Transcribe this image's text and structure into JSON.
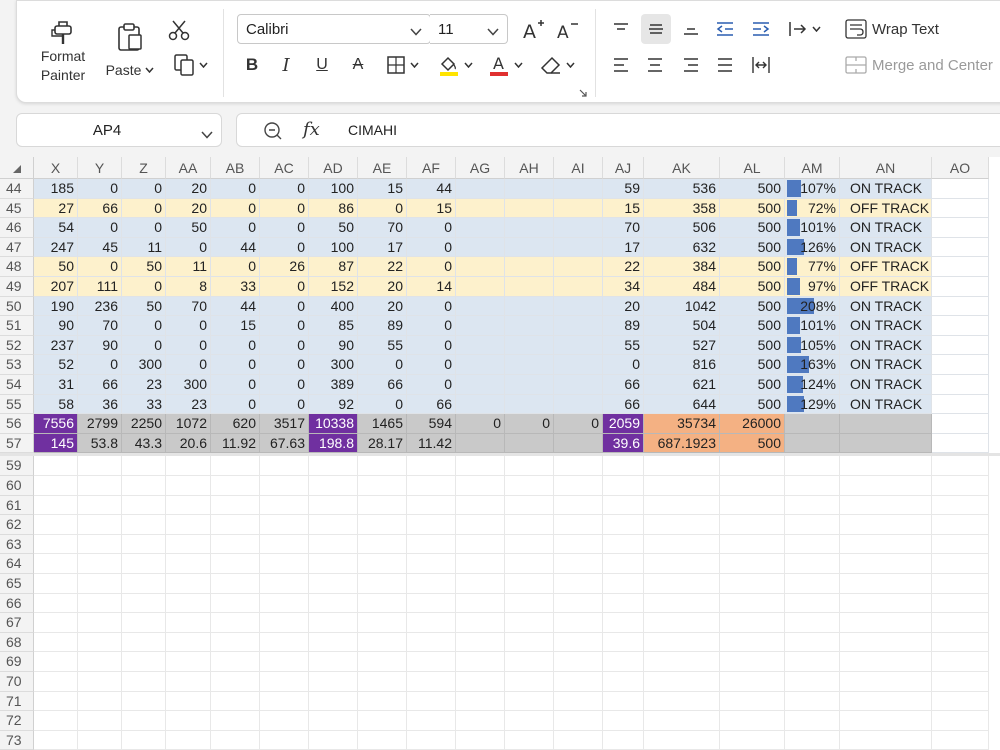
{
  "ribbon": {
    "format_painter_label_1": "Format",
    "format_painter_label_2": "Painter",
    "paste_label": "Paste",
    "font_name": "Calibri",
    "font_size": "11",
    "wrap_text_label": "Wrap Text",
    "merge_center_label": "Merge and Center"
  },
  "formula_bar": {
    "name_box": "AP4",
    "formula": "CIMAHI",
    "fx_label": "fx"
  },
  "colors": {
    "blue_row": "#dce6f1",
    "yellow_row": "#fdf1cc",
    "purple": "#7030a0",
    "gray": "#c9c9c9",
    "orange": "#f4b183",
    "databar": "#4f79c0"
  },
  "columns": [
    "X",
    "Y",
    "Z",
    "AA",
    "AB",
    "AC",
    "AD",
    "AE",
    "AF",
    "AG",
    "AH",
    "AI",
    "AJ",
    "AK",
    "AL",
    "AM",
    "AN",
    "AO"
  ],
  "rows": [
    {
      "num": "44",
      "style": "blue",
      "cells": [
        "185",
        "0",
        "0",
        "20",
        "0",
        "0",
        "100",
        "15",
        "44",
        "",
        "",
        "",
        "59",
        "536",
        "500",
        "107%",
        "ON TRACK"
      ],
      "bar": 0.29
    },
    {
      "num": "45",
      "style": "yellow",
      "cells": [
        "27",
        "66",
        "0",
        "20",
        "0",
        "0",
        "86",
        "0",
        "15",
        "",
        "",
        "",
        "15",
        "358",
        "500",
        "72%",
        "OFF TRACK"
      ],
      "bar": 0.2
    },
    {
      "num": "46",
      "style": "blue",
      "cells": [
        "54",
        "0",
        "0",
        "50",
        "0",
        "0",
        "50",
        "70",
        "0",
        "",
        "",
        "",
        "70",
        "506",
        "500",
        "101%",
        "ON TRACK"
      ],
      "bar": 0.27
    },
    {
      "num": "47",
      "style": "blue",
      "cells": [
        "247",
        "45",
        "11",
        "0",
        "44",
        "0",
        "100",
        "17",
        "0",
        "",
        "",
        "",
        "17",
        "632",
        "500",
        "126%",
        "ON TRACK"
      ],
      "bar": 0.34
    },
    {
      "num": "48",
      "style": "yellow",
      "cells": [
        "50",
        "0",
        "50",
        "11",
        "0",
        "26",
        "87",
        "22",
        "0",
        "",
        "",
        "",
        "22",
        "384",
        "500",
        "77%",
        "OFF TRACK"
      ],
      "bar": 0.21
    },
    {
      "num": "49",
      "style": "yellow",
      "cells": [
        "207",
        "111",
        "0",
        "8",
        "33",
        "0",
        "152",
        "20",
        "14",
        "",
        "",
        "",
        "34",
        "484",
        "500",
        "97%",
        "OFF TRACK"
      ],
      "bar": 0.26
    },
    {
      "num": "50",
      "style": "blue",
      "cells": [
        "190",
        "236",
        "50",
        "70",
        "44",
        "0",
        "400",
        "20",
        "0",
        "",
        "",
        "",
        "20",
        "1042",
        "500",
        "208%",
        "ON TRACK"
      ],
      "bar": 0.56
    },
    {
      "num": "51",
      "style": "blue",
      "cells": [
        "90",
        "70",
        "0",
        "0",
        "15",
        "0",
        "85",
        "89",
        "0",
        "",
        "",
        "",
        "89",
        "504",
        "500",
        "101%",
        "ON TRACK"
      ],
      "bar": 0.27
    },
    {
      "num": "52",
      "style": "blue",
      "cells": [
        "237",
        "90",
        "0",
        "0",
        "0",
        "0",
        "90",
        "55",
        "0",
        "",
        "",
        "",
        "55",
        "527",
        "500",
        "105%",
        "ON TRACK"
      ],
      "bar": 0.28
    },
    {
      "num": "53",
      "style": "blue",
      "cells": [
        "52",
        "0",
        "300",
        "0",
        "0",
        "0",
        "300",
        "0",
        "0",
        "",
        "",
        "",
        "0",
        "816",
        "500",
        "163%",
        "ON TRACK"
      ],
      "bar": 0.44
    },
    {
      "num": "54",
      "style": "blue",
      "cells": [
        "31",
        "66",
        "23",
        "300",
        "0",
        "0",
        "389",
        "66",
        "0",
        "",
        "",
        "",
        "66",
        "621",
        "500",
        "124%",
        "ON TRACK"
      ],
      "bar": 0.33
    },
    {
      "num": "55",
      "style": "blue",
      "cells": [
        "58",
        "36",
        "33",
        "23",
        "0",
        "0",
        "92",
        "0",
        "66",
        "",
        "",
        "",
        "66",
        "644",
        "500",
        "129%",
        "ON TRACK"
      ],
      "bar": 0.35
    },
    {
      "num": "56",
      "style": "total",
      "cells": [
        "7556",
        "2799",
        "2250",
        "1072",
        "620",
        "3517",
        "10338",
        "1465",
        "594",
        "0",
        "0",
        "0",
        "2059",
        "35734",
        "26000",
        "",
        ""
      ],
      "bar": 0
    },
    {
      "num": "57",
      "style": "total",
      "cells": [
        "145",
        "53.8",
        "43.3",
        "20.6",
        "11.92",
        "67.63",
        "198.8",
        "28.17",
        "11.42",
        "",
        "",
        "",
        "39.6",
        "687.1923",
        "500",
        "",
        ""
      ],
      "bar": 0
    }
  ],
  "empty_rows": [
    "59",
    "60",
    "61",
    "62",
    "63",
    "64",
    "65",
    "66",
    "67",
    "68",
    "69",
    "70",
    "71",
    "72",
    "73"
  ]
}
